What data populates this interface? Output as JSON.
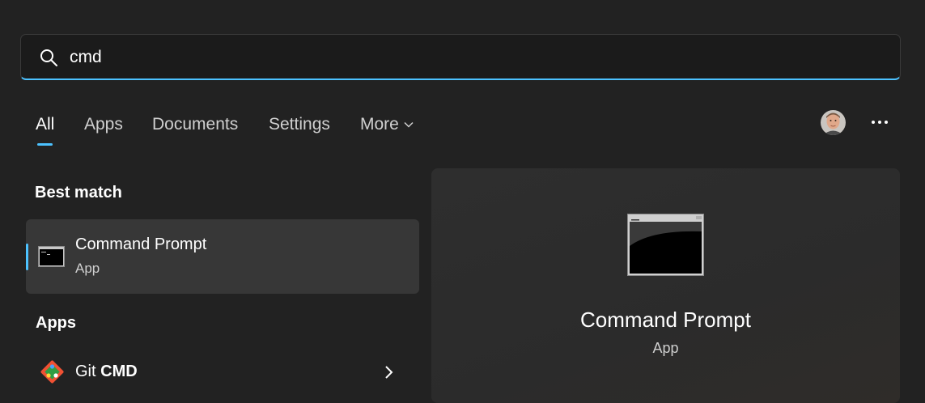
{
  "search": {
    "value": "cmd",
    "placeholder": ""
  },
  "tabs": [
    {
      "label": "All",
      "active": true
    },
    {
      "label": "Apps"
    },
    {
      "label": "Documents"
    },
    {
      "label": "Settings"
    },
    {
      "label": "More"
    }
  ],
  "sections": {
    "best_match": "Best match",
    "apps": "Apps"
  },
  "best_match": {
    "title": "Command Prompt",
    "subtitle": "App"
  },
  "apps": [
    {
      "label_prefix": "Git ",
      "label_bold": "CMD"
    }
  ],
  "preview": {
    "title": "Command Prompt",
    "subtitle": "App"
  },
  "icons": {
    "search": "search-icon",
    "more_chevron": "chevron-down-icon",
    "account": "user-avatar",
    "more_options": "more-horizontal-icon",
    "cmd": "command-prompt-icon",
    "git": "git-icon",
    "arrow": "chevron-right-icon"
  },
  "colors": {
    "accent": "#4cc2ff",
    "background": "#222222",
    "card": "#373737"
  }
}
